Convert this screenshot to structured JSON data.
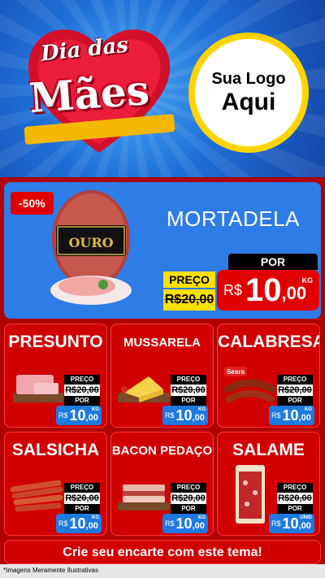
{
  "header": {
    "title_line1": "Dia das",
    "title_line2": "Mães",
    "logo_line1": "Sua Logo",
    "logo_line2": "Aqui"
  },
  "featured": {
    "discount": "-50%",
    "brand": "OURO",
    "name": "MORTADELA",
    "old_label": "PREÇO",
    "old_price": "R$20,00",
    "new_label": "POR",
    "currency": "R$",
    "price_int": "10",
    "price_dec": ",00",
    "unit": "KG"
  },
  "products": [
    {
      "name": "PRESUNTO",
      "old_label": "PREÇO",
      "old_price": "R$20,00",
      "new_label": "POR",
      "currency": "R$",
      "price_int": "10",
      "price_dec": ",00",
      "unit": "KG"
    },
    {
      "name": "MUSSARELA",
      "old_label": "PREÇO",
      "old_price": "R$20,00",
      "new_label": "POR",
      "currency": "R$",
      "price_int": "10",
      "price_dec": ",00",
      "unit": "KG"
    },
    {
      "name": "CALABRESA",
      "brand": "Seara",
      "old_label": "PREÇO",
      "old_price": "R$20,00",
      "new_label": "POR",
      "currency": "R$",
      "price_int": "10",
      "price_dec": ",00",
      "unit": "KG"
    },
    {
      "name": "SALSICHA",
      "old_label": "PREÇO",
      "old_price": "R$20,00",
      "new_label": "POR",
      "currency": "R$",
      "price_int": "10",
      "price_dec": ",00",
      "unit": "KG"
    },
    {
      "name": "BACON PEDAÇO",
      "old_label": "PREÇO",
      "old_price": "R$20,00",
      "new_label": "POR",
      "currency": "R$",
      "price_int": "10",
      "price_dec": ",00",
      "unit": "KG"
    },
    {
      "name": "SALAME",
      "old_label": "PREÇO",
      "old_price": "R$20,00",
      "new_label": "POR",
      "currency": "R$",
      "price_int": "10",
      "price_dec": ",00",
      "unit": "UNID"
    }
  ],
  "cta": "Crie seu encarte com este tema!",
  "footnote": "*Imagens Meramente Ilustrativas"
}
